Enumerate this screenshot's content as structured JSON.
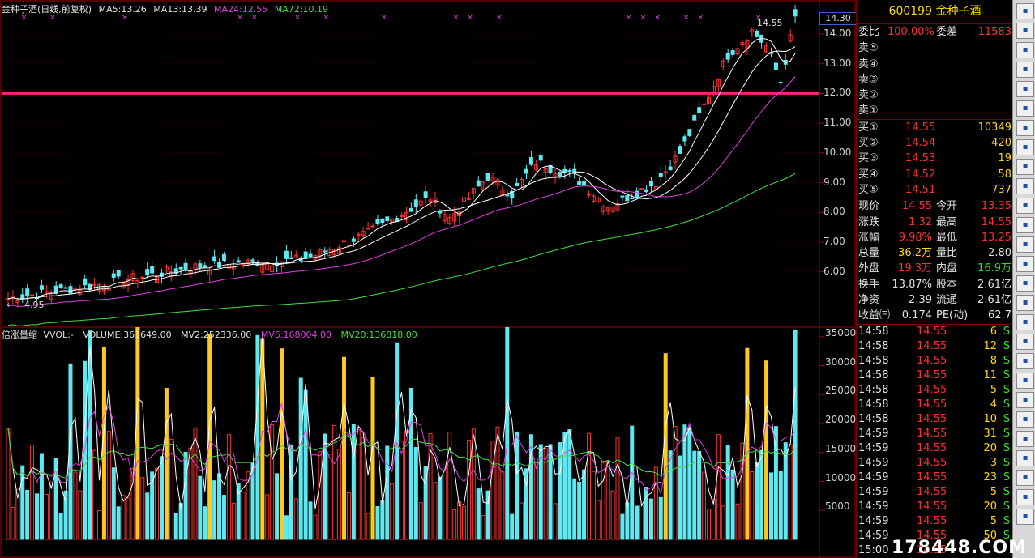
{
  "chart": {
    "legend": {
      "title": "金种子酒(日线,前复权)",
      "ma5": "MA5:13.26",
      "ma13": "MA13:13.39",
      "ma24": "MA24:12.55",
      "ma72": "MA72:10.19"
    },
    "price_box": "14.30",
    "high_label": "14.55",
    "low_label": "4.95",
    "price_axis": [
      "14.00",
      "13.00",
      "12.00",
      "11.00",
      "10.00",
      "9.00",
      "8.00",
      "7.00",
      "6.00"
    ],
    "vol_legend": {
      "name": "倍涨量缩",
      "vvol": "VVOL:-",
      "volume": "VOLUME:361649.00",
      "mv2": "MV2:252336.00",
      "mv6": "MV6:168004.00",
      "mv20": "MV20:136818.00"
    },
    "vol_axis": [
      "35000",
      "30000",
      "25000",
      "20000",
      "15000",
      "10000",
      "5000"
    ],
    "colors": {
      "up": "#ff3030",
      "down": "#5ee8f0",
      "ma5": "#ffffff",
      "ma13": "#ffffff",
      "ma24": "#e040e0",
      "ma72": "#40e040",
      "hline": "#ff2080",
      "limit": "#ffc820"
    }
  },
  "panel": {
    "code": "600199",
    "name": "金种子酒",
    "weibi_label": "委比",
    "weibi_value": "100.00%",
    "weicha_label": "委差",
    "weicha_value": "11583",
    "sells": [
      {
        "label": "卖⑤"
      },
      {
        "label": "卖④"
      },
      {
        "label": "卖③"
      },
      {
        "label": "卖②"
      },
      {
        "label": "卖①"
      }
    ],
    "buys": [
      {
        "label": "买①",
        "price": "14.55",
        "qty": "10349"
      },
      {
        "label": "买②",
        "price": "14.54",
        "qty": "420"
      },
      {
        "label": "买③",
        "price": "14.53",
        "qty": "19"
      },
      {
        "label": "买④",
        "price": "14.52",
        "qty": "58"
      },
      {
        "label": "买⑤",
        "price": "14.51",
        "qty": "737"
      }
    ],
    "stats": [
      {
        "l1": "现价",
        "v1": "14.55",
        "l2": "今开",
        "v2": "13.35",
        "c1": "red",
        "c2": "red"
      },
      {
        "l1": "涨跌",
        "v1": "1.32",
        "l2": "最高",
        "v2": "14.55",
        "c1": "red",
        "c2": "red"
      },
      {
        "l1": "涨幅",
        "v1": "9.98%",
        "l2": "最低",
        "v2": "13.25",
        "c1": "red",
        "c2": "red"
      },
      {
        "l1": "总量",
        "v1": "36.2万",
        "l2": "量比",
        "v2": "2.80",
        "c1": "yellow",
        "c2": "white"
      },
      {
        "l1": "外盘",
        "v1": "19.3万",
        "l2": "内盘",
        "v2": "16.9万",
        "c1": "red",
        "c2": "green"
      },
      {
        "l1": "换手",
        "v1": "13.87%",
        "l2": "股本",
        "v2": "2.61亿",
        "c1": "white",
        "c2": "white"
      },
      {
        "l1": "净资",
        "v1": "2.39",
        "l2": "流通",
        "v2": "2.61亿",
        "c1": "white",
        "c2": "white"
      },
      {
        "l1": "收益㈢",
        "v1": "0.174",
        "l2": "PE(动)",
        "v2": "62.7",
        "c1": "white",
        "c2": "white"
      }
    ],
    "ticks": [
      {
        "t": "14:58",
        "p": "14.55",
        "v": "6",
        "s": "S"
      },
      {
        "t": "14:58",
        "p": "14.55",
        "v": "12",
        "s": "S"
      },
      {
        "t": "14:58",
        "p": "14.55",
        "v": "8",
        "s": "S"
      },
      {
        "t": "14:58",
        "p": "14.55",
        "v": "11",
        "s": "S"
      },
      {
        "t": "14:58",
        "p": "14.55",
        "v": "5",
        "s": "S"
      },
      {
        "t": "14:58",
        "p": "14.55",
        "v": "4",
        "s": "S"
      },
      {
        "t": "14:58",
        "p": "14.55",
        "v": "10",
        "s": "S"
      },
      {
        "t": "14:59",
        "p": "14.55",
        "v": "31",
        "s": "S"
      },
      {
        "t": "14:59",
        "p": "14.55",
        "v": "20",
        "s": "S"
      },
      {
        "t": "14:59",
        "p": "14.55",
        "v": "3",
        "s": "S"
      },
      {
        "t": "14:59",
        "p": "14.55",
        "v": "23",
        "s": "S"
      },
      {
        "t": "14:59",
        "p": "14.55",
        "v": "5",
        "s": "S"
      },
      {
        "t": "14:59",
        "p": "14.55",
        "v": "20",
        "s": "S"
      },
      {
        "t": "14:59",
        "p": "14.55",
        "v": "5",
        "s": "S"
      },
      {
        "t": "14:59",
        "p": "14.55",
        "v": "50",
        "s": "S"
      },
      {
        "t": "15:00",
        "p": "14.55",
        "v": "",
        "s": ""
      }
    ]
  },
  "watermark": "178448.COM"
}
